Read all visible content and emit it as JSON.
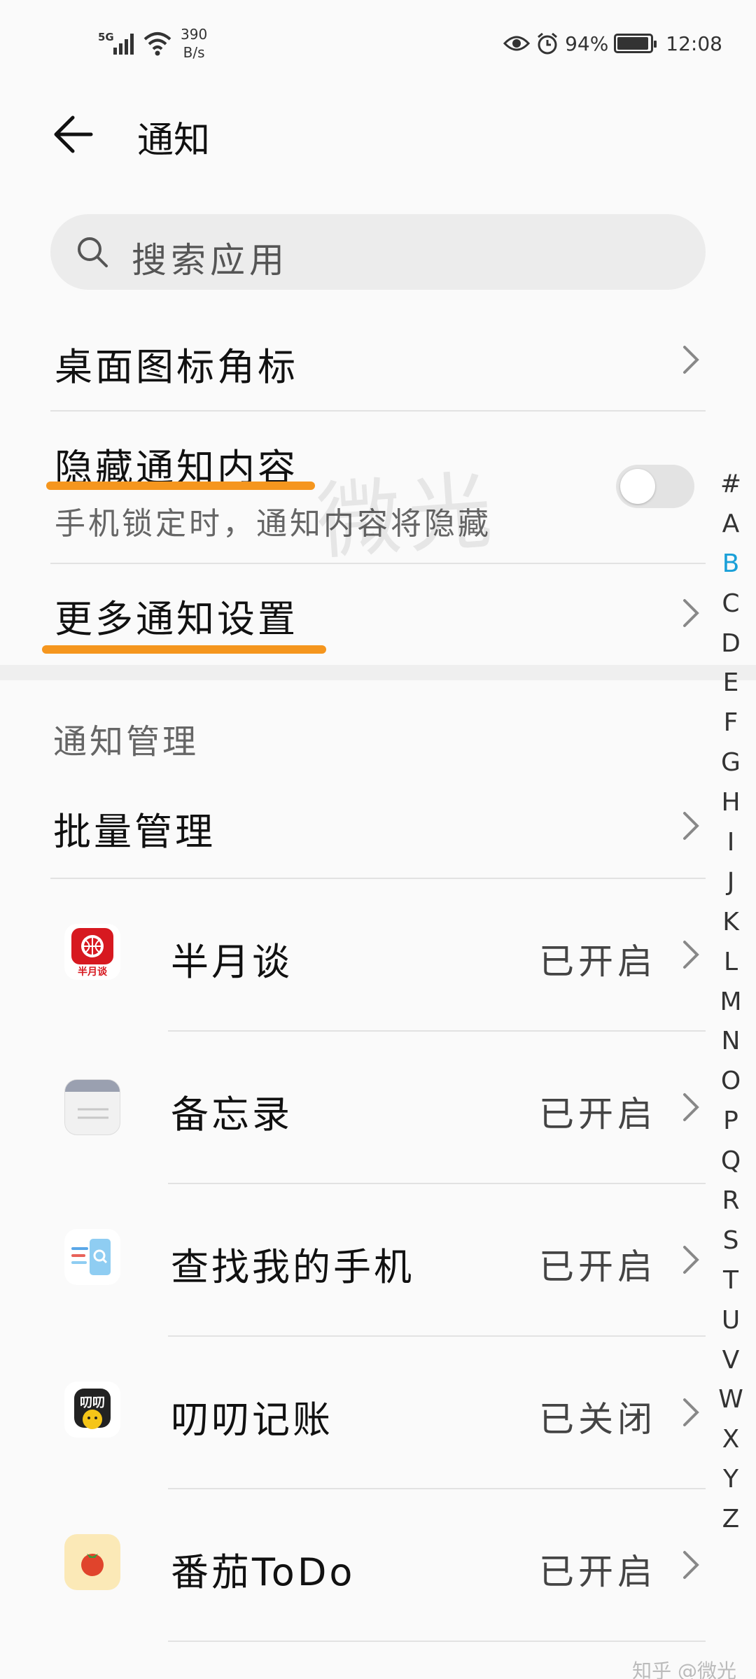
{
  "status_bar": {
    "network": "5G",
    "speed_value": "390",
    "speed_unit": "B/s",
    "battery_percent": "94%",
    "battery_level": 0.94,
    "time": "12:08",
    "icons": [
      "signal-icon",
      "wifi-icon",
      "eye-icon",
      "alarm-icon",
      "battery-icon"
    ]
  },
  "header": {
    "title": "通知"
  },
  "search": {
    "placeholder": "搜索应用"
  },
  "settings": {
    "badge": "桌面图标角标",
    "hide_content": {
      "label": "隐藏通知内容",
      "subtitle": "手机锁定时，通知内容将隐藏",
      "enabled": false
    },
    "more": "更多通知设置"
  },
  "management": {
    "section_title": "通知管理",
    "batch": "批量管理"
  },
  "apps": [
    {
      "name": "半月谈",
      "status": "已开启",
      "icon": "banyuetan-icon",
      "icon_text": "半月谈"
    },
    {
      "name": "备忘录",
      "status": "已开启",
      "icon": "memo-icon"
    },
    {
      "name": "查找我的手机",
      "status": "已开启",
      "icon": "find-phone-icon"
    },
    {
      "name": "叨叨记账",
      "status": "已关闭",
      "icon": "daodao-icon",
      "icon_text": "叨叨"
    },
    {
      "name": "番茄ToDo",
      "status": "已开启",
      "icon": "tomato-icon"
    }
  ],
  "alphabet": [
    "#",
    "A",
    "B",
    "C",
    "D",
    "E",
    "F",
    "G",
    "H",
    "I",
    "J",
    "K",
    "L",
    "M",
    "N",
    "O",
    "P",
    "Q",
    "R",
    "S",
    "T",
    "U",
    "V",
    "W",
    "X",
    "Y",
    "Z"
  ],
  "alphabet_active": "B",
  "watermark": "微光",
  "credit": "知乎 @微光",
  "colors": {
    "highlight": "#f5961e",
    "accent": "#1aa0d8"
  }
}
